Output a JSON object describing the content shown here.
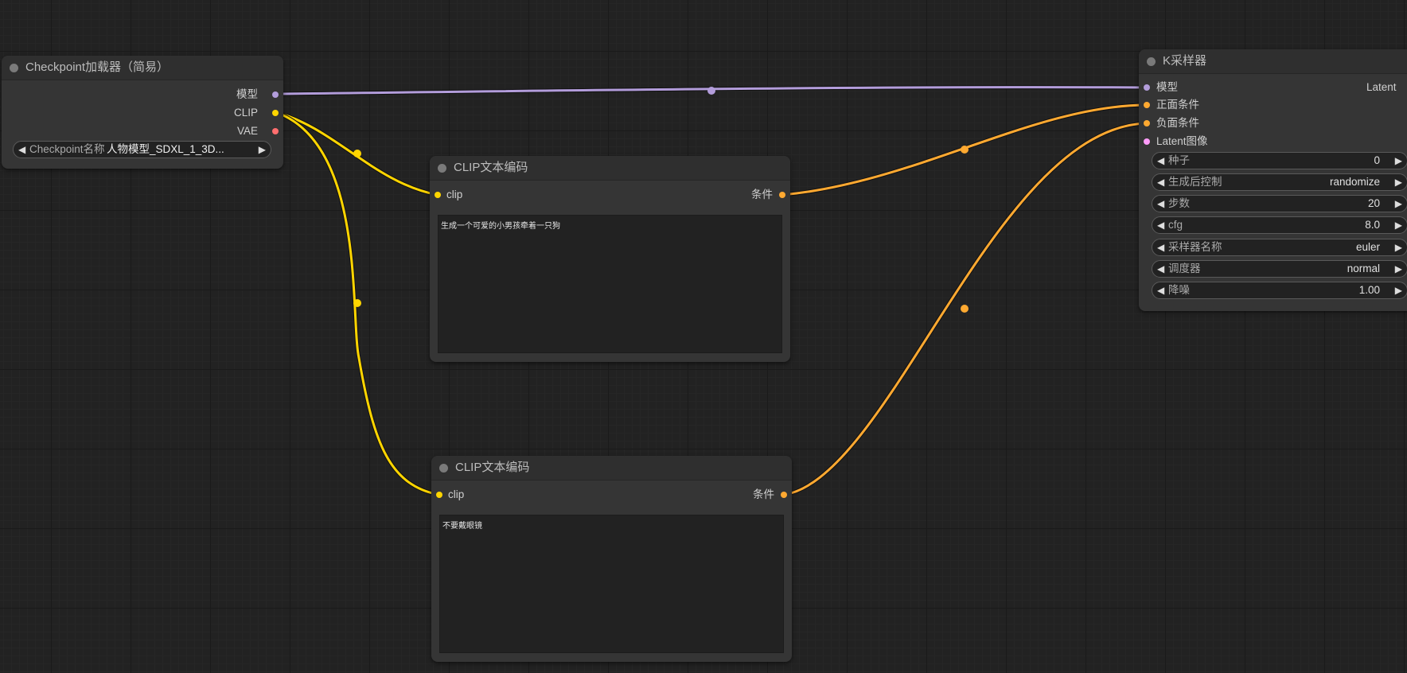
{
  "colors": {
    "background": "#222222",
    "model_link": "#b39ddb",
    "clip_link": "#ffd500",
    "conditioning_link": "#ffa931",
    "vae_slot": "#ff6e6e",
    "latent_slot": "#ff9cf9"
  },
  "checkpoint_node": {
    "title": "Checkpoint加载器（简易）",
    "outputs": {
      "model": "模型",
      "clip": "CLIP",
      "vae": "VAE"
    },
    "widget": {
      "name": "Checkpoint名称",
      "value": "人物模型_SDXL_1_3D..."
    }
  },
  "clip_encode_positive": {
    "title": "CLIP文本编码",
    "input_label": "clip",
    "output_label": "条件",
    "text": "生成一个可爱的小男孩牵着一只狗"
  },
  "clip_encode_negative": {
    "title": "CLIP文本编码",
    "input_label": "clip",
    "output_label": "条件",
    "text": "不要戴眼镜"
  },
  "ksampler_node": {
    "title": "K采样器",
    "inputs": {
      "model": "模型",
      "positive": "正面条件",
      "negative": "负面条件",
      "latent_image": "Latent图像"
    },
    "output_label": "Latent",
    "widgets": [
      {
        "name": "种子",
        "value": "0"
      },
      {
        "name": "生成后控制",
        "value": "randomize"
      },
      {
        "name": "步数",
        "value": "20"
      },
      {
        "name": "cfg",
        "value": "8.0"
      },
      {
        "name": "采样器名称",
        "value": "euler"
      },
      {
        "name": "调度器",
        "value": "normal"
      },
      {
        "name": "降噪",
        "value": "1.00"
      }
    ]
  }
}
